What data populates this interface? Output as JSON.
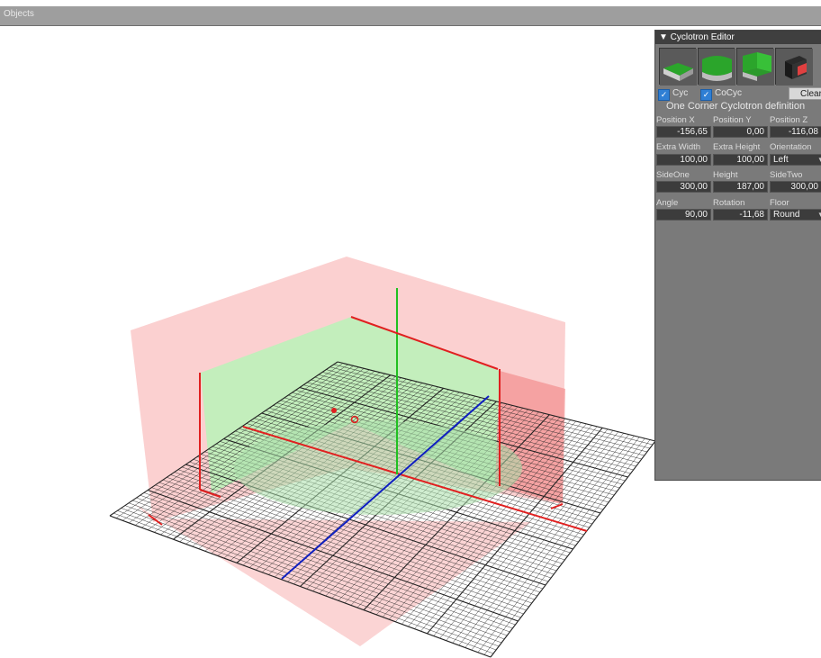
{
  "window": {
    "title": "Objects"
  },
  "editor": {
    "header": "▼ Cyclotron Editor",
    "thumbnails": [
      {
        "name": "cyclorama-flat-preset"
      },
      {
        "name": "cyclorama-round-preset"
      },
      {
        "name": "cyclorama-corner-preset"
      },
      {
        "name": "cyclorama-dark-preset"
      }
    ],
    "cyc_label": "Cyc",
    "cocyc_label": "CoCyc",
    "cyc_checked": true,
    "cocyc_checked": true,
    "clear_label": "Clear",
    "definition_title": "One Corner Cyclotron definition",
    "rows": [
      {
        "labels": [
          "Position X",
          "Position Y",
          "Position Z"
        ],
        "values": [
          "-156,65",
          "0,00",
          "-116,08"
        ]
      },
      {
        "labels": [
          "Extra Width",
          "Extra Height",
          "Orientation"
        ],
        "values": [
          "100,00",
          "100,00",
          "Left"
        ]
      },
      {
        "labels": [
          "SideOne",
          "Height",
          "SideTwo"
        ],
        "values": [
          "300,00",
          "187,00",
          "300,00"
        ]
      },
      {
        "labels": [
          "Angle",
          "Rotation",
          "Floor"
        ],
        "values": [
          "90,00",
          "-11,68",
          "Round"
        ]
      }
    ]
  },
  "scene": {
    "colors": {
      "outer_wall": "#f8b0b0",
      "inner_wall": "#b9f3b9",
      "floor_disc": "#a9dfa9",
      "grid_line": "#222222",
      "axis_x": "#e02020",
      "axis_y": "#20c020",
      "axis_z": "#1020c0"
    }
  }
}
